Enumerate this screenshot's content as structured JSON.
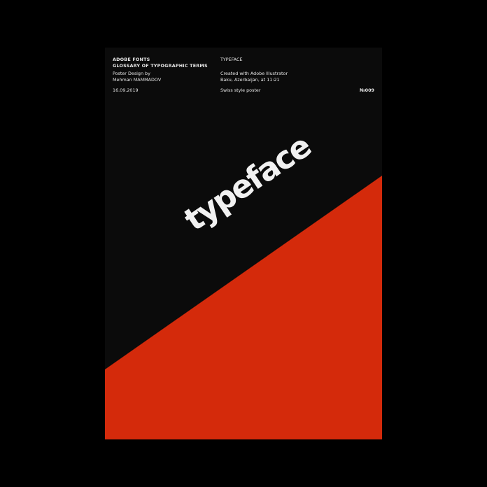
{
  "poster": {
    "header_left": {
      "line1": "ADOBE FONTS",
      "line2": "GLOSSARY OF TYPOGRAPHIC TERMS",
      "line3": "Poster Design by",
      "line4": "Mehman MAMMADOV",
      "date": "16.09.2019"
    },
    "header_right": {
      "title": "TYPEFACE",
      "line1": "Created with Adobe Illustrator",
      "line2": "Baku, Azerbaijan, at 11:21",
      "style_note": "Swiss style poster"
    },
    "number": "№009",
    "big_word": "typeface",
    "colors": {
      "background": "#000000",
      "poster": "#0b0b0b",
      "accent_red": "#d42a0b",
      "text": "#f1f1f1"
    }
  }
}
